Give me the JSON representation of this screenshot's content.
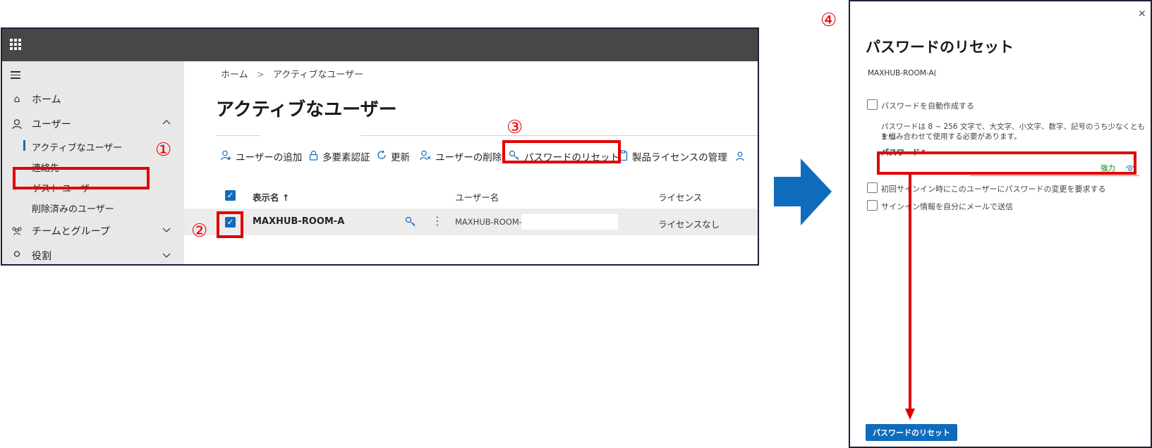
{
  "nav": {
    "home": "ホーム",
    "users": "ユーザー",
    "active_users": "アクティブなユーザー",
    "contacts": "連絡先",
    "guest_users": "ゲスト ユーザー",
    "deleted_users": "削除済みのユーザー",
    "teams_groups": "チームとグループ",
    "roles": "役割"
  },
  "breadcrumb": {
    "home": "ホーム",
    "separator": ">",
    "current": "アクティブなユーザー"
  },
  "page_title": "アクティブなユーザー",
  "toolbar": {
    "add_user": "ユーザーの追加",
    "mfa": "多要素認証",
    "refresh": "更新",
    "delete_user": "ユーザーの削除",
    "reset_password": "パスワードのリセット",
    "manage_licenses": "製品ライセンスの管理"
  },
  "table": {
    "columns": [
      "表示名 ↑",
      "ユーザー名",
      "ライセンス"
    ],
    "rows": [
      {
        "display_name": "MAXHUB-ROOM-A",
        "username": "MAXHUB-ROOM-A",
        "license": "ライセンスなし"
      }
    ]
  },
  "annotations": {
    "step1": "①",
    "step2": "②",
    "step3": "③",
    "step4": "④"
  },
  "panel": {
    "title": "パスワードのリセット",
    "user": "MAXHUB-ROOM-A(",
    "auto_create": "パスワードを自動作成する",
    "help_line1": "パスワードは 8 ~ 256 文字で、大文字、小文字、数字、記号のうち少なくとも 3 つ",
    "help_line2": "を組み合わせて使用する必要があります。",
    "password_label": "パスワード",
    "required_mark": "*",
    "strength": "強力",
    "require_change": "初回サインイン時にこのユーザーにパスワードの変更を要求する",
    "email_me": "サインイン情報を自分にメールで送信",
    "reset_button": "パスワードのリセット"
  },
  "colors": {
    "accent": "#0f6cbd",
    "annotation_red": "#e10000",
    "topbar": "#474747",
    "arrow": "#0f6cbd",
    "strength": "#107c10"
  }
}
